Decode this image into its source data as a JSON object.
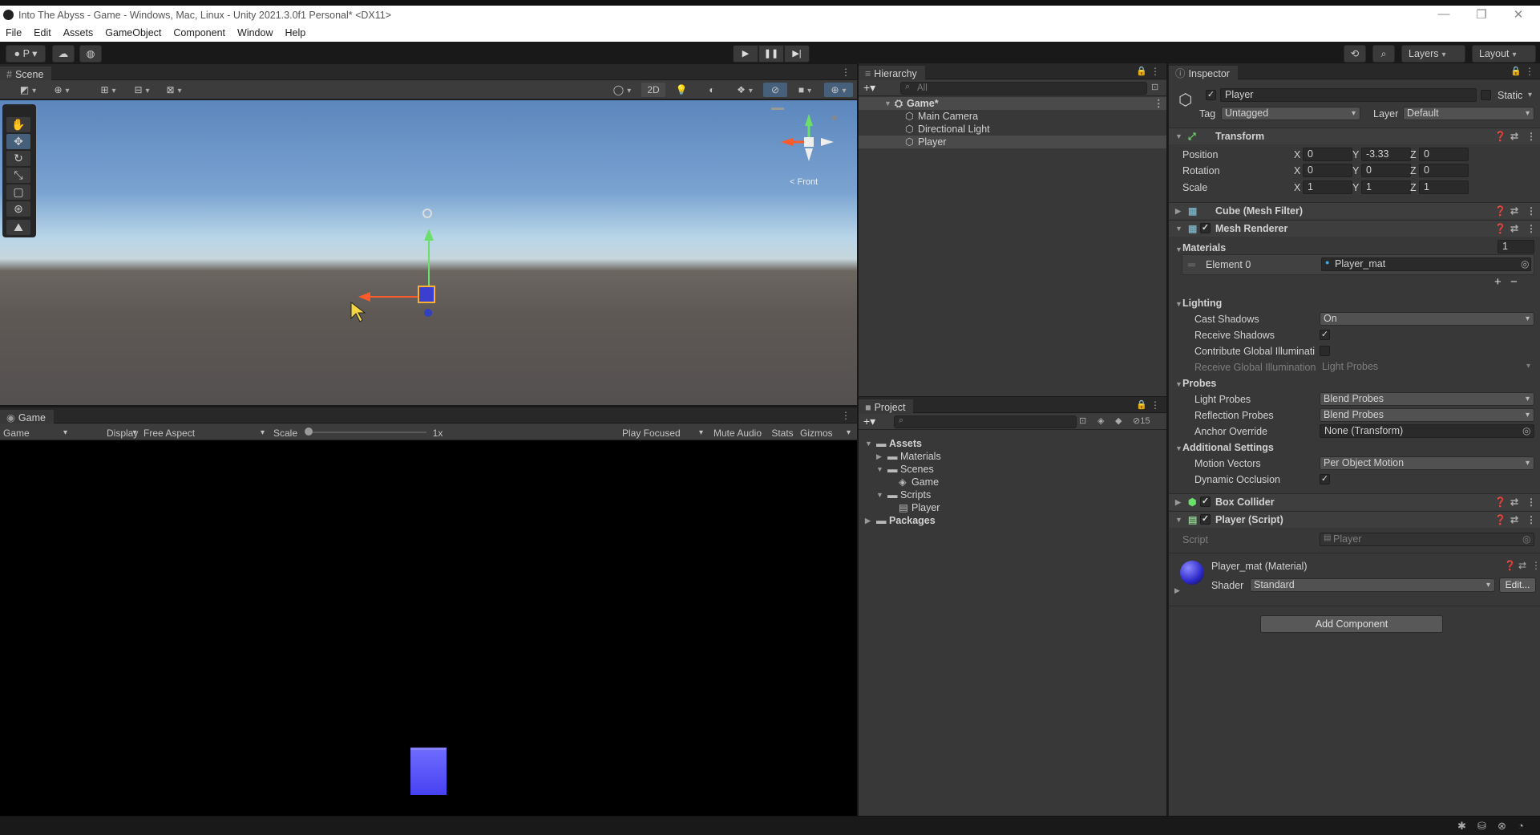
{
  "window": {
    "title": "Into The Abyss - Game - Windows, Mac, Linux - Unity 2021.3.0f1 Personal* <DX11>",
    "minimize": "—",
    "maximize": "❐",
    "close": "✕"
  },
  "menu": [
    "File",
    "Edit",
    "Assets",
    "GameObject",
    "Component",
    "Window",
    "Help"
  ],
  "toolbar": {
    "account": "P",
    "layers": "Layers",
    "layout": "Layout"
  },
  "scene": {
    "tab": "Scene",
    "toggle_2d": "2D",
    "gizmo_label": "< Front"
  },
  "game": {
    "tab": "Game",
    "mode": "Game",
    "display": "Display 1",
    "aspect": "Free Aspect",
    "scale_label": "Scale",
    "scale_value": "1x",
    "play_focused": "Play Focused",
    "mute": "Mute Audio",
    "stats": "Stats",
    "gizmos": "Gizmos"
  },
  "hierarchy": {
    "tab": "Hierarchy",
    "search_placeholder": "All",
    "scene": "Game*",
    "items": [
      "Main Camera",
      "Directional Light",
      "Player"
    ]
  },
  "project": {
    "tab": "Project",
    "hidden_count": "15",
    "tree": [
      {
        "label": "Assets",
        "depth": 0,
        "kind": "folder",
        "bold": true
      },
      {
        "label": "Materials",
        "depth": 1,
        "kind": "folder"
      },
      {
        "label": "Scenes",
        "depth": 1,
        "kind": "folder"
      },
      {
        "label": "Game",
        "depth": 2,
        "kind": "scene"
      },
      {
        "label": "Scripts",
        "depth": 1,
        "kind": "folder"
      },
      {
        "label": "Player",
        "depth": 2,
        "kind": "script"
      },
      {
        "label": "Packages",
        "depth": 0,
        "kind": "folder",
        "bold": true
      }
    ]
  },
  "inspector": {
    "tab": "Inspector",
    "name": "Player",
    "static_label": "Static",
    "tag_label": "Tag",
    "tag": "Untagged",
    "layer_label": "Layer",
    "layer": "Default",
    "transform": {
      "title": "Transform",
      "position_label": "Position",
      "rotation_label": "Rotation",
      "scale_label": "Scale",
      "position": {
        "x": "0",
        "y": "-3.33",
        "z": "0"
      },
      "rotation": {
        "x": "0",
        "y": "0",
        "z": "0"
      },
      "scale": {
        "x": "1",
        "y": "1",
        "z": "1"
      }
    },
    "mesh_filter": "Cube (Mesh Filter)",
    "mesh_renderer": "Mesh Renderer",
    "materials": {
      "label": "Materials",
      "count": "1",
      "element_label": "Element 0",
      "element_value": "Player_mat"
    },
    "lighting": {
      "label": "Lighting",
      "cast_shadows_label": "Cast Shadows",
      "cast_shadows": "On",
      "receive_shadows_label": "Receive Shadows",
      "contribute_gi_label": "Contribute Global Illuminati",
      "receive_gi_label": "Receive Global Illumination",
      "receive_gi": "Light Probes"
    },
    "probes": {
      "label": "Probes",
      "light_probes_label": "Light Probes",
      "light_probes": "Blend Probes",
      "reflection_label": "Reflection Probes",
      "reflection": "Blend Probes",
      "anchor_label": "Anchor Override",
      "anchor": "None (Transform)"
    },
    "additional": {
      "label": "Additional Settings",
      "motion_label": "Motion Vectors",
      "motion": "Per Object Motion",
      "occlusion_label": "Dynamic Occlusion"
    },
    "box_collider": "Box Collider",
    "player_script": {
      "title": "Player (Script)",
      "script_label": "Script",
      "script": "Player"
    },
    "material": {
      "title": "Player_mat (Material)",
      "shader_label": "Shader",
      "shader": "Standard",
      "edit": "Edit..."
    },
    "add_component": "Add Component"
  },
  "colors": {
    "accent": "#46607c",
    "cube": "#5550ff"
  }
}
